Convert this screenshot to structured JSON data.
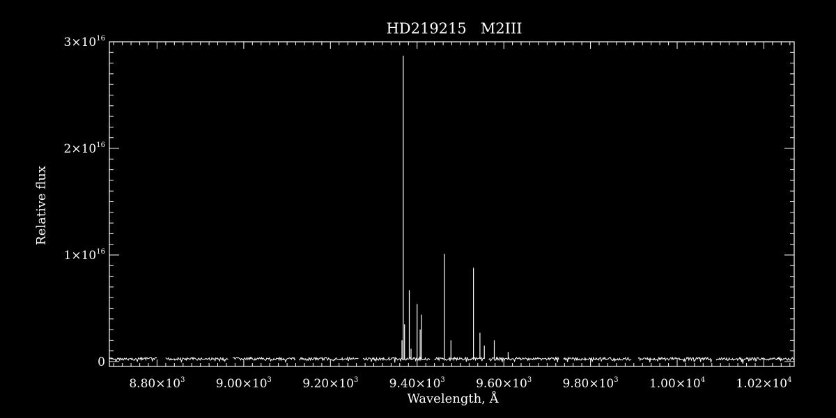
{
  "chart_data": {
    "type": "line",
    "title": "HD219215   M2III",
    "xlabel": "Wavelength, Å",
    "ylabel": "Relative flux",
    "xlim": [
      8690,
      10270
    ],
    "ylim": [
      0,
      3e+16
    ],
    "grid": false,
    "colors": {
      "background": "#000000",
      "foreground": "#ffffff"
    },
    "x_ticks": [
      {
        "value": 8800,
        "mantissa": "8.80",
        "exponent": "3"
      },
      {
        "value": 9000,
        "mantissa": "9.00",
        "exponent": "3"
      },
      {
        "value": 9200,
        "mantissa": "9.20",
        "exponent": "3"
      },
      {
        "value": 9400,
        "mantissa": "9.40",
        "exponent": "3"
      },
      {
        "value": 9600,
        "mantissa": "9.60",
        "exponent": "3"
      },
      {
        "value": 9800,
        "mantissa": "9.80",
        "exponent": "3"
      },
      {
        "value": 10000,
        "mantissa": "1.00",
        "exponent": "4"
      },
      {
        "value": 10200,
        "mantissa": "1.02",
        "exponent": "4"
      }
    ],
    "y_ticks": [
      {
        "value": 0,
        "mantissa": "0",
        "exponent": ""
      },
      {
        "value": 1e+16,
        "mantissa": "1",
        "exponent": "16"
      },
      {
        "value": 2e+16,
        "mantissa": "2",
        "exponent": "16"
      },
      {
        "value": 3e+16,
        "mantissa": "3",
        "exponent": "16"
      }
    ],
    "continuum": {
      "level": 250000000000000.0,
      "segments": [
        [
          8690,
          8800
        ],
        [
          8820,
          8965
        ],
        [
          8975,
          9120
        ],
        [
          9128,
          9265
        ],
        [
          9275,
          9430
        ],
        [
          9440,
          9555
        ],
        [
          9565,
          9728
        ],
        [
          9738,
          9895
        ],
        [
          9910,
          10080
        ],
        [
          10090,
          10270
        ]
      ]
    },
    "peaks": [
      {
        "x": 9365,
        "y": 2000000000000000.0
      },
      {
        "x": 9368,
        "y": 2.87e+16
      },
      {
        "x": 9371,
        "y": 3500000000000000.0
      },
      {
        "x": 9382,
        "y": 6700000000000000.0
      },
      {
        "x": 9386,
        "y": 1200000000000000.0
      },
      {
        "x": 9400,
        "y": 5400000000000000.0
      },
      {
        "x": 9407,
        "y": 3000000000000000.0
      },
      {
        "x": 9410,
        "y": 4400000000000000.0
      },
      {
        "x": 9463,
        "y": 1.01e+16
      },
      {
        "x": 9478,
        "y": 2000000000000000.0
      },
      {
        "x": 9530,
        "y": 8800000000000000.0
      },
      {
        "x": 9545,
        "y": 2700000000000000.0
      },
      {
        "x": 9555,
        "y": 1500000000000000.0
      },
      {
        "x": 9578,
        "y": 2000000000000000.0
      },
      {
        "x": 9610,
        "y": 900000000000000.0
      }
    ]
  }
}
